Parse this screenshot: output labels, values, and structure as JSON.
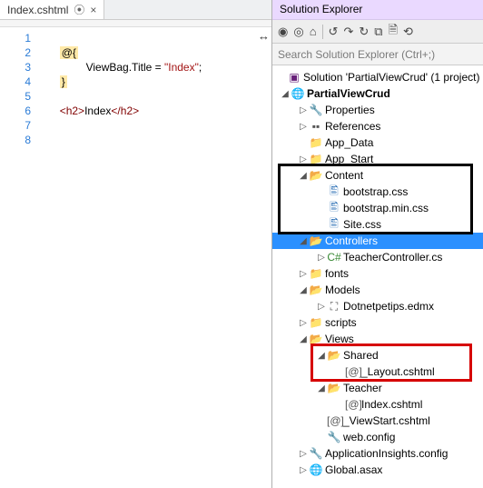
{
  "editor": {
    "tab_label": "Index.cshtml",
    "tab_pin_icon": "⦿",
    "tab_close_icon": "×",
    "line1": "@{",
    "line2_code": "ViewBag.Title = ",
    "line2_str": "\"Index\"",
    "line2_end": ";",
    "line3": "}",
    "line5_open": "<h2>",
    "line5_text": "Index",
    "line5_close": "</h2>",
    "line_numbers": [
      "1",
      "2",
      "3",
      "4",
      "5",
      "6",
      "7",
      "8"
    ]
  },
  "se": {
    "title": "Solution Explorer",
    "search_placeholder": "Search Solution Explorer (Ctrl+;)",
    "toolbar_icons": [
      "◉",
      "◎",
      "⌂",
      "|",
      "↺",
      "↷",
      "↻",
      "⧉",
      "🗎",
      "⟲"
    ],
    "solution_label": "Solution 'PartialViewCrud' (1 project)",
    "project": "PartialViewCrud",
    "properties": "Properties",
    "references": "References",
    "app_data": "App_Data",
    "app_start": "App_Start",
    "content": "Content",
    "bootstrap_css": "bootstrap.css",
    "bootstrap_min_css": "bootstrap.min.css",
    "site_css": "Site.css",
    "controllers": "Controllers",
    "teacher_controller": "TeacherController.cs",
    "fonts": "fonts",
    "models": "Models",
    "edmx": "Dotnetpetips.edmx",
    "scripts": "scripts",
    "views": "Views",
    "shared": "Shared",
    "layout": "_Layout.cshtml",
    "teacher": "Teacher",
    "index_cshtml": "Index.cshtml",
    "viewstart": "_ViewStart.cshtml",
    "web_config": "web.config",
    "appinsights": "ApplicationInsights.config",
    "global_asax": "Global.asax"
  }
}
